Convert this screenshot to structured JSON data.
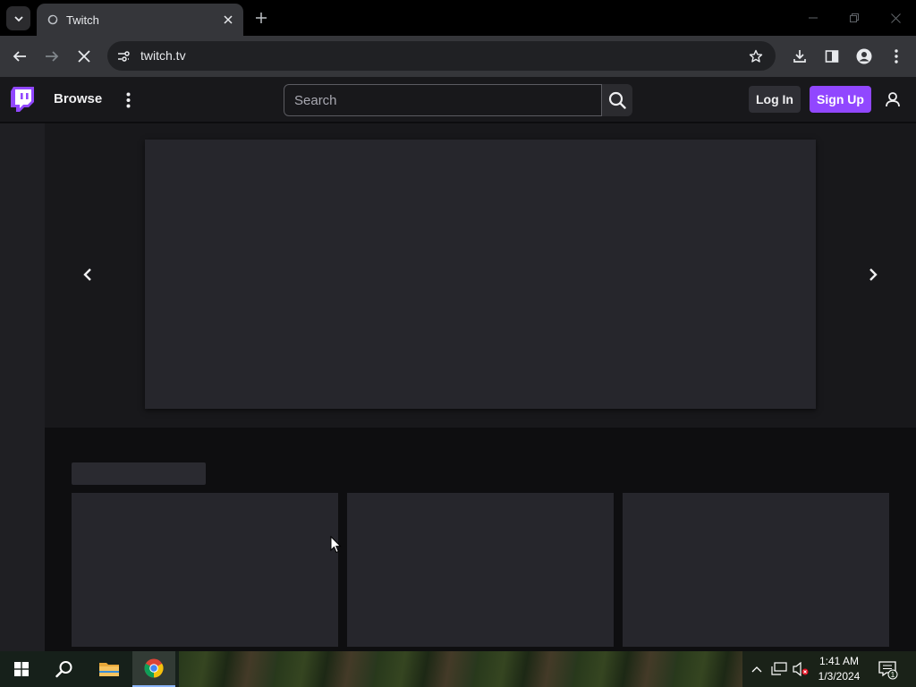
{
  "browser": {
    "tab_title": "Twitch",
    "url": "twitch.tv"
  },
  "twitch": {
    "browse_label": "Browse",
    "search_placeholder": "Search",
    "login_label": "Log In",
    "signup_label": "Sign Up"
  },
  "taskbar": {
    "time": "1:41 AM",
    "date": "1/3/2024",
    "notification_count": "1"
  },
  "colors": {
    "twitch_purple": "#9147ff",
    "page_bg": "#0e0e10",
    "nav_bg": "#18181b",
    "placeholder": "#26262c"
  },
  "icons": [
    "tab-list-icon",
    "twitch-favicon",
    "close-icon",
    "plus-icon",
    "minimize-icon",
    "restore-icon",
    "back-arrow-icon",
    "forward-arrow-icon",
    "stop-loading-icon",
    "site-settings-icon",
    "star-icon",
    "download-icon",
    "side-panel-icon",
    "profile-icon",
    "kebab-menu-icon",
    "twitch-logo",
    "more-icon",
    "search-icon",
    "user-icon",
    "chevron-left-icon",
    "chevron-right-icon",
    "windows-start-icon",
    "search-taskbar-icon",
    "file-explorer-icon",
    "chrome-icon",
    "chevron-up-icon",
    "network-icon",
    "volume-muted-icon",
    "notification-icon"
  ]
}
